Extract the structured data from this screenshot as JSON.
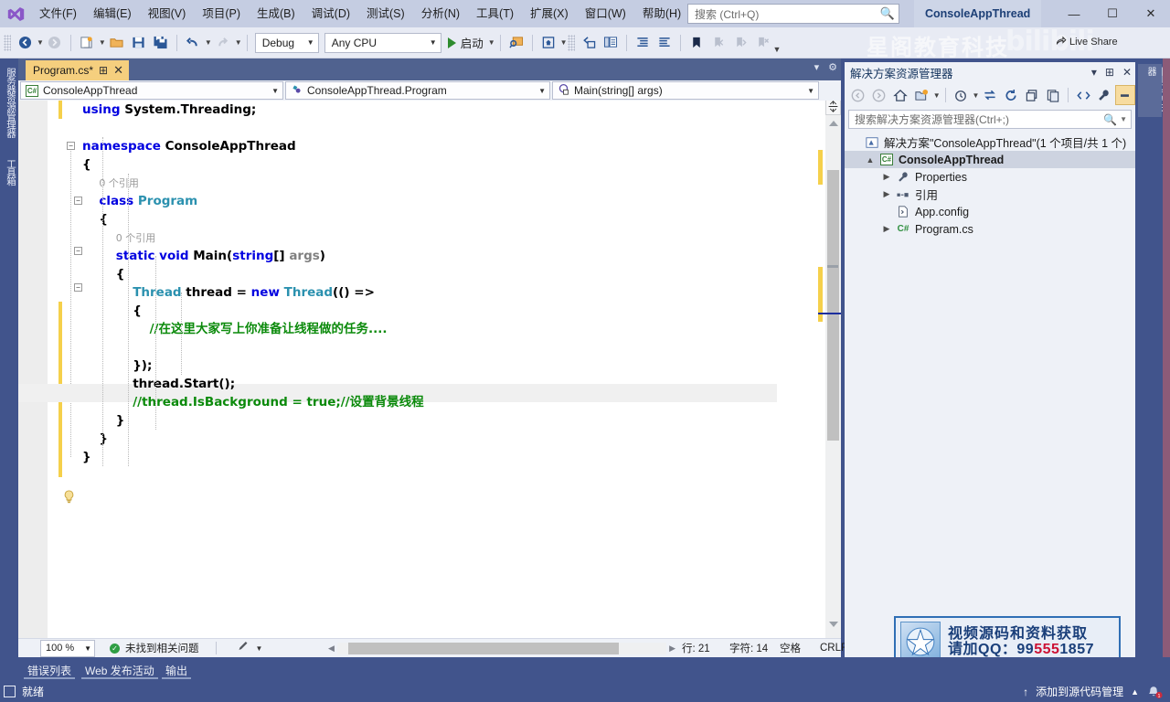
{
  "titlebar": {
    "menus": [
      {
        "label": "文件(F)"
      },
      {
        "label": "编辑(E)"
      },
      {
        "label": "视图(V)"
      },
      {
        "label": "项目(P)"
      },
      {
        "label": "生成(B)"
      },
      {
        "label": "调试(D)"
      },
      {
        "label": "测试(S)"
      },
      {
        "label": "分析(N)"
      },
      {
        "label": "工具(T)"
      },
      {
        "label": "扩展(X)"
      },
      {
        "label": "窗口(W)"
      },
      {
        "label": "帮助(H)"
      }
    ],
    "search_placeholder": "搜索 (Ctrl+Q)",
    "project_title": "ConsoleAppThread",
    "minimize": "—",
    "maximize": "☐",
    "close": "✕"
  },
  "toolbar": {
    "config": "Debug",
    "platform": "Any CPU",
    "run_label": "启动",
    "icons": {
      "back": "navigate-back-icon",
      "forward": "navigate-forward-icon",
      "new_project": "new-project-icon",
      "open": "open-file-icon",
      "save": "save-icon",
      "save_all": "save-all-icon",
      "undo": "undo-icon",
      "redo": "redo-icon",
      "attach": "attach-process-icon",
      "home": "home-icon",
      "window": "window-icon",
      "copy_lines": "copy-icon",
      "indent": "indent-icon",
      "outdent": "outdent-icon",
      "bookmark": "bookmark-icon",
      "bm_prev": "bookmark-prev-icon",
      "bm_next": "bookmark-next-icon",
      "bm_clear": "bookmark-clear-icon"
    }
  },
  "left_strip": {
    "tabs": [
      "服务器资源管理器",
      "工具箱"
    ]
  },
  "right_strip": {
    "tabs": [
      "团队资源管理器"
    ]
  },
  "editor": {
    "tab": {
      "filename": "Program.cs*",
      "pin_icon": "pin-icon",
      "close_icon": "close-icon"
    },
    "navbar": {
      "project": "ConsoleAppThread",
      "project_icon": "csharp-file-icon",
      "type": "ConsoleAppThread.Program",
      "type_icon": "class-icon",
      "member": "Main(string[] args)",
      "member_icon": "method-icon"
    },
    "code_lines": [
      {
        "indent": 0,
        "tokens": [
          {
            "t": "using ",
            "c": "kw"
          },
          {
            "t": "System.Threading;",
            "c": ""
          }
        ]
      },
      {
        "indent": 0,
        "tokens": []
      },
      {
        "indent": 0,
        "tokens": [
          {
            "t": "namespace ",
            "c": "kw"
          },
          {
            "t": "ConsoleAppThread",
            "c": ""
          }
        ]
      },
      {
        "indent": 0,
        "tokens": [
          {
            "t": "{",
            "c": ""
          }
        ]
      },
      {
        "indent": 2,
        "tokens": [
          {
            "t": "0 个引用",
            "c": "ref"
          }
        ]
      },
      {
        "indent": 2,
        "tokens": [
          {
            "t": "class ",
            "c": "kw"
          },
          {
            "t": "Program",
            "c": "typ"
          }
        ]
      },
      {
        "indent": 2,
        "tokens": [
          {
            "t": "{",
            "c": ""
          }
        ]
      },
      {
        "indent": 4,
        "tokens": [
          {
            "t": "0 个引用",
            "c": "ref"
          }
        ]
      },
      {
        "indent": 4,
        "tokens": [
          {
            "t": "static void ",
            "c": "kw"
          },
          {
            "t": "Main(",
            "c": ""
          },
          {
            "t": "string",
            "c": "kw"
          },
          {
            "t": "[] ",
            "c": ""
          },
          {
            "t": "args",
            "c": "par"
          },
          {
            "t": ")",
            "c": ""
          }
        ]
      },
      {
        "indent": 4,
        "tokens": [
          {
            "t": "{",
            "c": ""
          }
        ]
      },
      {
        "indent": 6,
        "tokens": [
          {
            "t": "Thread ",
            "c": "typ"
          },
          {
            "t": "thread = ",
            "c": ""
          },
          {
            "t": "new ",
            "c": "kw"
          },
          {
            "t": "Thread",
            "c": "typ"
          },
          {
            "t": "(() =>",
            "c": ""
          }
        ]
      },
      {
        "indent": 6,
        "tokens": [
          {
            "t": "{",
            "c": ""
          }
        ]
      },
      {
        "indent": 8,
        "tokens": [
          {
            "t": "//在这里大家写上你准备让线程做的任务....",
            "c": "cmt"
          }
        ]
      },
      {
        "indent": 8,
        "tokens": []
      },
      {
        "indent": 6,
        "tokens": [
          {
            "t": "});",
            "c": ""
          }
        ]
      },
      {
        "indent": 6,
        "tokens": [
          {
            "t": "thread.Start();",
            "c": ""
          }
        ]
      },
      {
        "indent": 6,
        "tokens": [
          {
            "t": "//",
            "c": "cmt"
          },
          {
            "t": "thread.IsBackground = true;//设置背景线程",
            "c": "cmt"
          }
        ]
      },
      {
        "indent": 4,
        "tokens": [
          {
            "t": "}",
            "c": ""
          }
        ]
      },
      {
        "indent": 2,
        "tokens": [
          {
            "t": "}",
            "c": ""
          }
        ]
      },
      {
        "indent": 0,
        "tokens": [
          {
            "t": "}",
            "c": ""
          }
        ]
      }
    ],
    "lightbulb_icon": "lightbulb-icon"
  },
  "editor_status": {
    "zoom": "100 %",
    "issues": "未找到相关问题",
    "issues_icon": "checkmark-circle-icon",
    "pencil_icon": "pencil-dropdown-icon",
    "line": "行: 21",
    "column": "字符: 14",
    "spaces": "空格",
    "eol": "CRLF"
  },
  "solution_explorer": {
    "title": "解决方案资源管理器",
    "header_icons": {
      "dropdown": "chevron-down-icon",
      "pin": "pin-icon",
      "close": "close-icon"
    },
    "toolbar_icons": [
      "back-icon",
      "forward-icon",
      "home-icon",
      "pending-changes-icon",
      "view-dropdown-icon",
      "sync-with-document-icon",
      "refresh-icon",
      "collapse-all-icon",
      "show-all-files-icon",
      "code-view-icon",
      "properties-icon",
      "preview-selected-items-icon"
    ],
    "search_placeholder": "搜索解决方案资源管理器(Ctrl+;)",
    "search_icon": "magnifier-icon",
    "tree": [
      {
        "level": 0,
        "arrow": "",
        "icon": "solution-icon",
        "label": "解决方案\"ConsoleAppThread\"(1 个项目/共 1 个)",
        "bold": false,
        "selected": false
      },
      {
        "level": 1,
        "arrow": "▲",
        "icon": "csharp-project-icon",
        "label": "ConsoleAppThread",
        "bold": true,
        "selected": true
      },
      {
        "level": 2,
        "arrow": "▶",
        "icon": "wrench-icon",
        "label": "Properties",
        "bold": false,
        "selected": false
      },
      {
        "level": 2,
        "arrow": "▶",
        "icon": "references-icon",
        "label": "引用",
        "bold": false,
        "selected": false
      },
      {
        "level": 2,
        "arrow": "",
        "icon": "config-file-icon",
        "label": "App.config",
        "bold": false,
        "selected": false
      },
      {
        "level": 2,
        "arrow": "▶",
        "icon": "csharp-file-icon",
        "label": "Program.cs",
        "bold": false,
        "selected": false
      }
    ]
  },
  "bottom_tabs": [
    {
      "label": "错误列表"
    },
    {
      "label": "Web 发布活动"
    },
    {
      "label": "输出"
    }
  ],
  "statusbar": {
    "ready_icon": "ready-icon",
    "ready": "就绪",
    "source_control_arrow": "↑",
    "source_control": "添加到源代码管理",
    "source_control_caret": "▲",
    "bell_icon": "notification-bell-icon",
    "bell_count": "1"
  },
  "watermarks": {
    "brand": "星阁教育科技",
    "bilibili": "bilibili",
    "live_share": "Live Share",
    "live_share_icon": "live-share-icon",
    "qq_line1": "视频源码和资料获取",
    "qq_line2_pre": "请加QQ：",
    "qq_line2_a": "99",
    "qq_line2_red": "555",
    "qq_line2_b": "1857",
    "qq_logo_icon": "star-logo-icon"
  },
  "colors": {
    "title_bg": "#c5cde2",
    "chrome_bg": "#41548c",
    "toolbar_bg": "#e8ebf4",
    "editor_bg": "#ffffff",
    "tab_active": "#f5cf7e",
    "keyword": "#0000e0",
    "type": "#2b91af",
    "comment": "#0b8a0b",
    "accent": "#2b5797"
  }
}
